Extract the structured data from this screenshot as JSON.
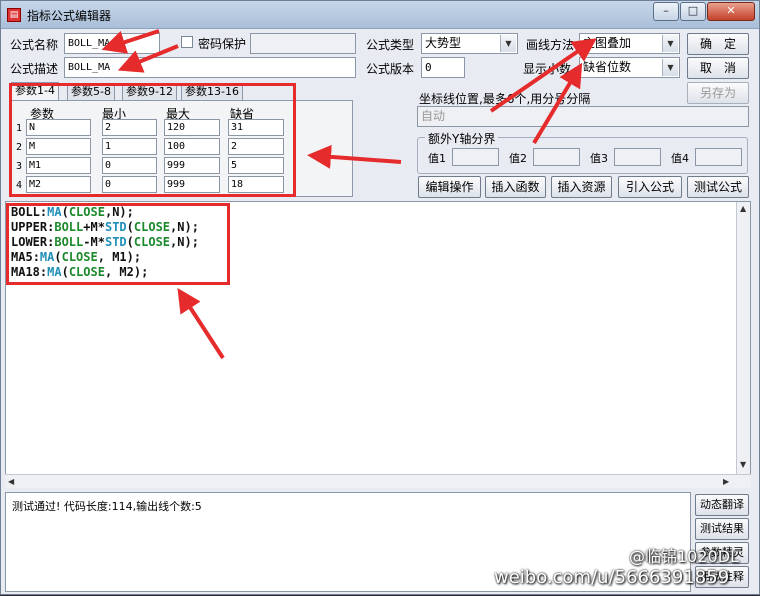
{
  "window": {
    "title": "指标公式编辑器",
    "controls": {
      "minimize": "–",
      "maximize": "□",
      "close": "✕"
    }
  },
  "form": {
    "name_label": "公式名称",
    "name_value": "BOLL_MA",
    "password_label": "密码保护",
    "desc_label": "公式描述",
    "desc_value": "BOLL_MA",
    "type_label": "公式类型",
    "type_value": "大势型",
    "version_label": "公式版本",
    "version_value": "0",
    "draw_label": "画线方法",
    "draw_value": "主图叠加",
    "decimal_label": "显示小数",
    "decimal_value": "缺省位数"
  },
  "buttons": {
    "ok": "确　定",
    "cancel": "取　消",
    "save_as": "另存为",
    "edit_ops": "编辑操作",
    "insert_func": "插入函数",
    "insert_res": "插入资源",
    "import": "引入公式",
    "test": "测试公式",
    "dyn_translate": "动态翻译",
    "test_result": "测试结果",
    "param_tips": "参数精灵",
    "usage_notes": "用法注释"
  },
  "param_tabs": [
    "参数1-4",
    "参数5-8",
    "参数9-12",
    "参数13-16"
  ],
  "param_headers": [
    "参数",
    "最小",
    "最大",
    "缺省"
  ],
  "params": [
    {
      "idx": "1",
      "name": "N",
      "min": "2",
      "max": "120",
      "def": "31"
    },
    {
      "idx": "2",
      "name": "M",
      "min": "1",
      "max": "100",
      "def": "2"
    },
    {
      "idx": "3",
      "name": "M1",
      "min": "0",
      "max": "999",
      "def": "5"
    },
    {
      "idx": "4",
      "name": "M2",
      "min": "0",
      "max": "999",
      "def": "18"
    }
  ],
  "axis": {
    "label": "坐标线位置,最多6个,用分号分隔",
    "value": "自动",
    "group_title": "额外Y轴分界",
    "v1": "值1",
    "v2": "值2",
    "v3": "值3",
    "v4": "值4"
  },
  "code": {
    "l1": {
      "name": "BOLL",
      "fn": "MA",
      "var": "CLOSE",
      "arg": "N"
    },
    "l2": {
      "name": "UPPER",
      "base": "BOLL",
      "op": "+",
      "k": "M",
      "mul": "*",
      "fn": "STD",
      "var": "CLOSE",
      "arg": "N"
    },
    "l3": {
      "name": "LOWER",
      "base": "BOLL",
      "op": "-",
      "k": "M",
      "mul": "*",
      "fn": "STD",
      "var": "CLOSE",
      "arg": "N"
    },
    "l4": {
      "name": "MA5",
      "fn": "MA",
      "var": "CLOSE",
      "arg": "M1"
    },
    "l5": {
      "name": "MA18",
      "fn": "MA",
      "var": "CLOSE",
      "arg": "M2"
    }
  },
  "status_message": "测试通过! 代码长度:114,输出线个数:5",
  "watermark": {
    "handle": "@临锦1020DL",
    "url": "weibo.com/u/5666391859"
  },
  "colors": {
    "annotation": "#e52b2b",
    "function": "#2090b8",
    "variable": "#1c8a2c"
  }
}
